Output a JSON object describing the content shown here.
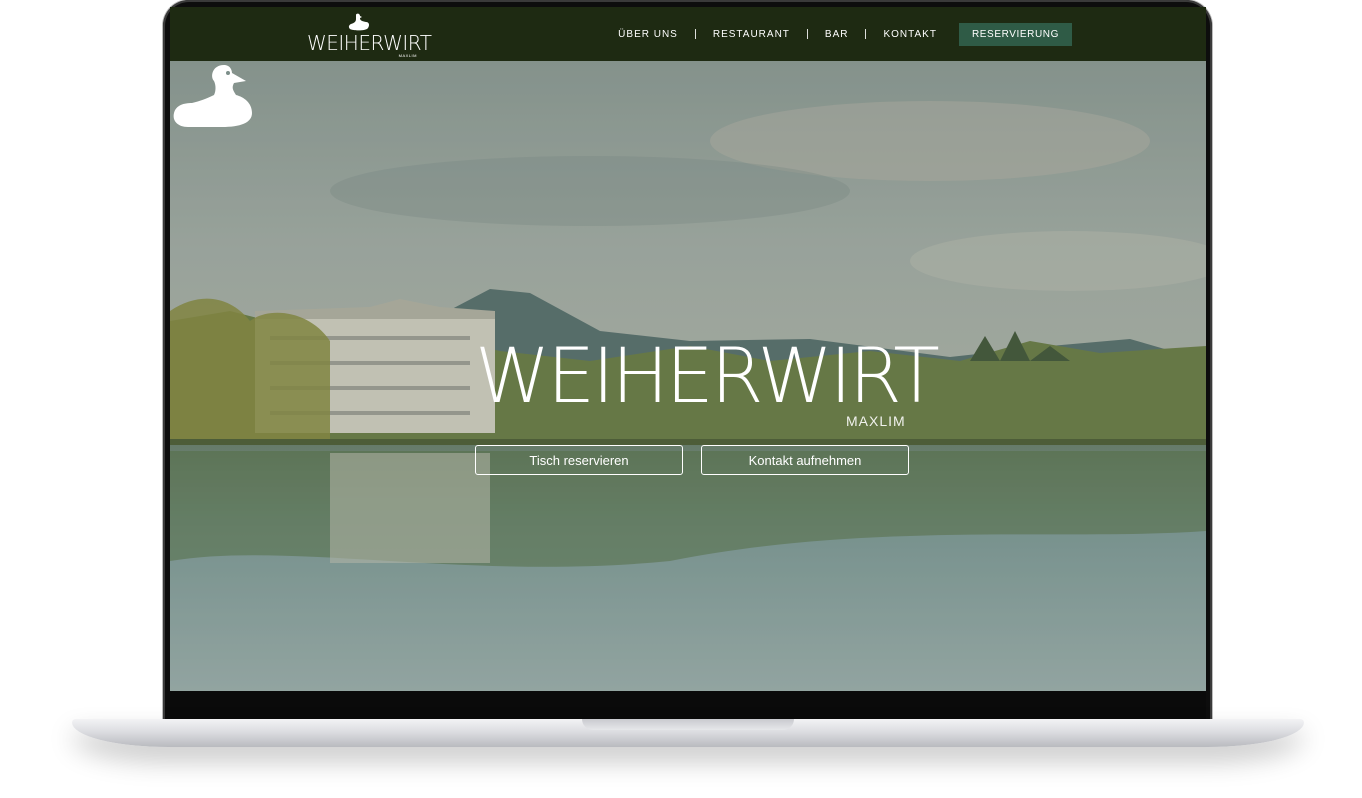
{
  "site": {
    "logo_text": "WEIHERWIRT",
    "logo_sub": "MAXLIM"
  },
  "nav": {
    "items": [
      {
        "label": "ÜBER UNS"
      },
      {
        "label": "RESTAURANT"
      },
      {
        "label": "BAR"
      },
      {
        "label": "KONTAKT"
      }
    ],
    "cta": "RESERVIERUNG"
  },
  "hero": {
    "title": "WEIHERWIRT",
    "subtitle": "MAXLIM",
    "buttons": [
      {
        "label": "Tisch reservieren"
      },
      {
        "label": "Kontakt aufnehmen"
      }
    ]
  },
  "colors": {
    "navbar": "#1e2a12",
    "cta": "#2f5b46"
  },
  "icons": {
    "logo": "duck-icon",
    "hero": "duck-icon"
  }
}
